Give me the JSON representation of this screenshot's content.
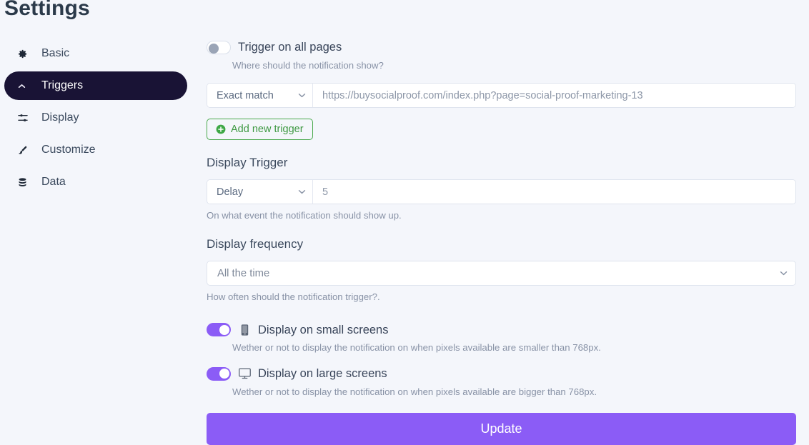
{
  "page": {
    "title": "Settings"
  },
  "sidebar": {
    "items": [
      {
        "label": "Basic",
        "icon": "gear-icon",
        "active": false
      },
      {
        "label": "Triggers",
        "icon": "chevron-up-icon",
        "active": true
      },
      {
        "label": "Display",
        "icon": "sliders-icon",
        "active": false
      },
      {
        "label": "Customize",
        "icon": "paintbrush-icon",
        "active": false
      },
      {
        "label": "Data",
        "icon": "database-icon",
        "active": false
      }
    ]
  },
  "main": {
    "trigger_all_pages": {
      "label": "Trigger on all pages",
      "state": "off",
      "help": "Where should the notification show?"
    },
    "url_rule": {
      "match_type": "Exact match",
      "url": "https://buysocialproof.com/index.php?page=social-proof-marketing-13"
    },
    "add_trigger_button": {
      "label": "Add new trigger",
      "icon": "plus-circle-icon"
    },
    "display_trigger": {
      "title": "Display Trigger",
      "event": "Delay",
      "value": "5",
      "help": "On what event the notification should show up."
    },
    "display_frequency": {
      "title": "Display frequency",
      "value": "All the time",
      "help": "How often should the notification trigger?."
    },
    "small_screens": {
      "label": "Display on small screens",
      "icon": "mobile-icon",
      "state": "on",
      "help": "Wether or not to display the notification on when pixels available are smaller than 768px."
    },
    "large_screens": {
      "label": "Display on large screens",
      "icon": "monitor-icon",
      "state": "on",
      "help": "Wether or not to display the notification on when pixels available are bigger than 768px."
    },
    "update_button": {
      "label": "Update"
    }
  },
  "colors": {
    "accent": "#8b5cf6",
    "sidebar_active_bg": "#191335",
    "page_bg": "#f4f6fb",
    "add_button_green": "#3e9942"
  }
}
